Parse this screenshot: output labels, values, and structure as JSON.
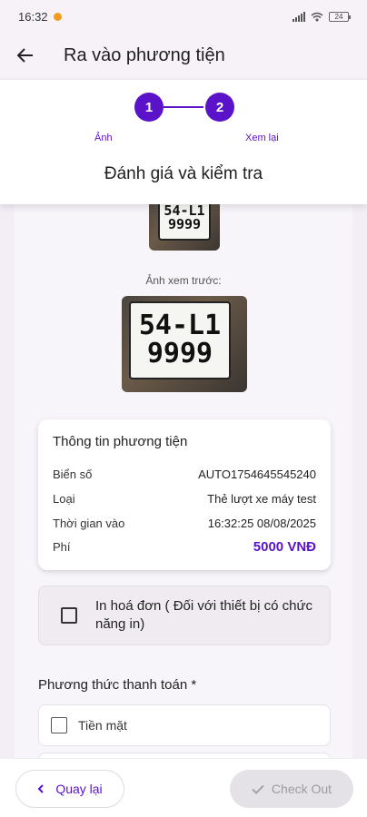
{
  "status_bar": {
    "time": "16:32",
    "battery": "24"
  },
  "app_bar": {
    "title": "Ra vào phương tiện"
  },
  "stepper": {
    "steps": [
      {
        "number": "1",
        "label": "Ảnh"
      },
      {
        "number": "2",
        "label": "Xem lại"
      }
    ],
    "title": "Đánh giá và kiểm tra"
  },
  "preview": {
    "label": "Ảnh xem trước:",
    "plate_line1": "54-L1",
    "plate_line2": "9999"
  },
  "vehicle_info": {
    "title": "Thông tin phương tiện",
    "rows": [
      {
        "label": "Biển số",
        "value": "AUTO1754645545240"
      },
      {
        "label": "Loại",
        "value": "Thẻ lượt xe máy test"
      },
      {
        "label": "Thời gian vào",
        "value": "16:32:25 08/08/2025"
      },
      {
        "label": "Phí",
        "value": "5000 VNĐ"
      }
    ]
  },
  "invoice": {
    "label": "In hoá đơn ( Đối với thiết bị có chức năng in)",
    "checked": false
  },
  "payment": {
    "label": "Phương thức thanh toán *",
    "options": [
      {
        "label": "Tiền mặt",
        "checked": false
      }
    ]
  },
  "footer": {
    "back_label": "Quay lại",
    "checkout_label": "Check Out"
  },
  "colors": {
    "accent": "#5b13c9",
    "background": "#f3eef6",
    "disabled": "#e4e2e6"
  },
  "icons": [
    "arrow-left-icon",
    "wifi-icon",
    "signal-icon",
    "battery-icon",
    "chevron-left-icon",
    "check-icon"
  ]
}
